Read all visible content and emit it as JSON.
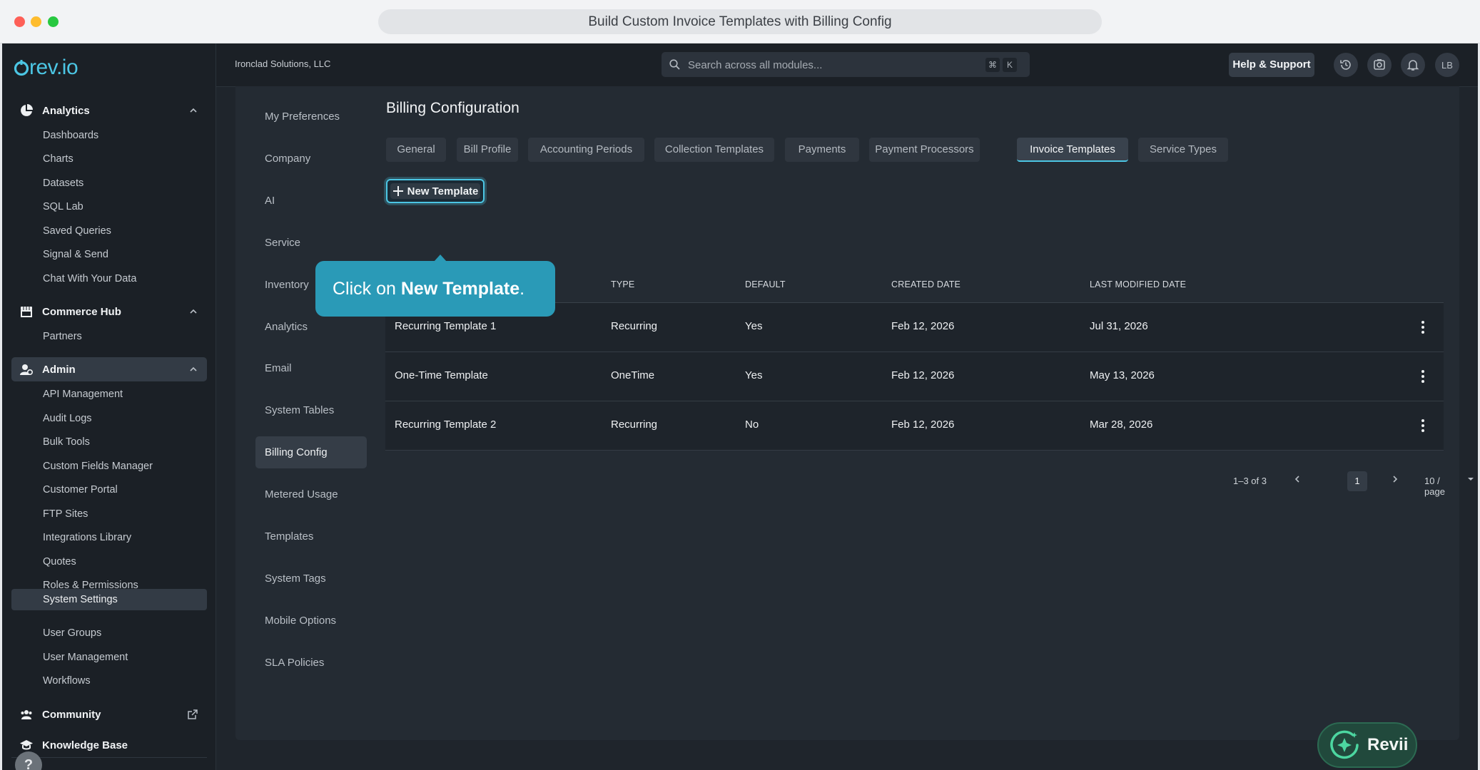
{
  "window": {
    "title": "Build Custom Invoice Templates with Billing Config"
  },
  "brand": {
    "logo_text": "rev.io",
    "accent": "#4cc6e4"
  },
  "header": {
    "org_name": "Ironclad Solutions, LLC",
    "search_placeholder": "Search across all modules...",
    "shortcut_keys": [
      "⌘",
      "K"
    ],
    "help_label": "Help & Support",
    "icons": [
      "history-icon",
      "screenshot-icon",
      "bell-icon"
    ],
    "avatar_initials": "LB"
  },
  "sidebar": {
    "sections": [
      {
        "label": "Analytics",
        "icon": "pie-chart-icon",
        "expanded": true,
        "items": [
          "Dashboards",
          "Charts",
          "Datasets",
          "SQL Lab",
          "Saved Queries",
          "Signal & Send",
          "Chat With Your Data"
        ]
      },
      {
        "label": "Commerce Hub",
        "icon": "store-icon",
        "expanded": true,
        "items": [
          "Partners"
        ]
      },
      {
        "label": "Admin",
        "icon": "admin-icon",
        "expanded": true,
        "active": true,
        "items": [
          "API Management",
          "Audit Logs",
          "Bulk Tools",
          "Custom Fields Manager",
          "Customer Portal",
          "FTP Sites",
          "Integrations Library",
          "Quotes",
          "Roles & Permissions",
          "System Settings",
          "User Groups",
          "User Management",
          "Workflows"
        ],
        "active_item": "System Settings"
      },
      {
        "label": "Community",
        "icon": "community-icon",
        "external": true
      },
      {
        "label": "Knowledge Base",
        "icon": "graduation-cap-icon"
      }
    ],
    "help_glyph": "?"
  },
  "settings_nav": {
    "items": [
      "My Preferences",
      "Company",
      "AI",
      "Service",
      "Inventory",
      "Analytics",
      "Email",
      "System Tables",
      "Billing Config",
      "Metered Usage",
      "Templates",
      "System Tags",
      "Mobile Options",
      "SLA Policies"
    ],
    "active": "Billing Config"
  },
  "main": {
    "title": "Billing Configuration",
    "tabs": [
      "General",
      "Bill Profile",
      "Accounting Periods",
      "Collection Templates",
      "Payments",
      "Payment Processors",
      "Invoice Templates",
      "Service Types"
    ],
    "active_tab": "Invoice Templates",
    "new_button_label": "New Template",
    "table": {
      "columns": [
        "TYPE",
        "DEFAULT",
        "CREATED DATE",
        "LAST MODIFIED DATE"
      ],
      "rows": [
        {
          "name": "Recurring Template 1",
          "type": "Recurring",
          "default": "Yes",
          "created": "Feb 12, 2026",
          "modified": "Jul 31, 2026"
        },
        {
          "name": "One-Time Template",
          "type": "OneTime",
          "default": "Yes",
          "created": "Feb 12, 2026",
          "modified": "May 13, 2026"
        },
        {
          "name": "Recurring Template 2",
          "type": "Recurring",
          "default": "No",
          "created": "Feb 12, 2026",
          "modified": "Mar 28, 2026"
        }
      ]
    },
    "pagination": {
      "range": "1–3 of 3",
      "page": "1",
      "page_size": "10 / page"
    }
  },
  "tooltip": {
    "prefix": "Click on ",
    "emphasis": "New Template",
    "suffix": "."
  },
  "assistant": {
    "label": "Revii",
    "color": "#21493c"
  }
}
